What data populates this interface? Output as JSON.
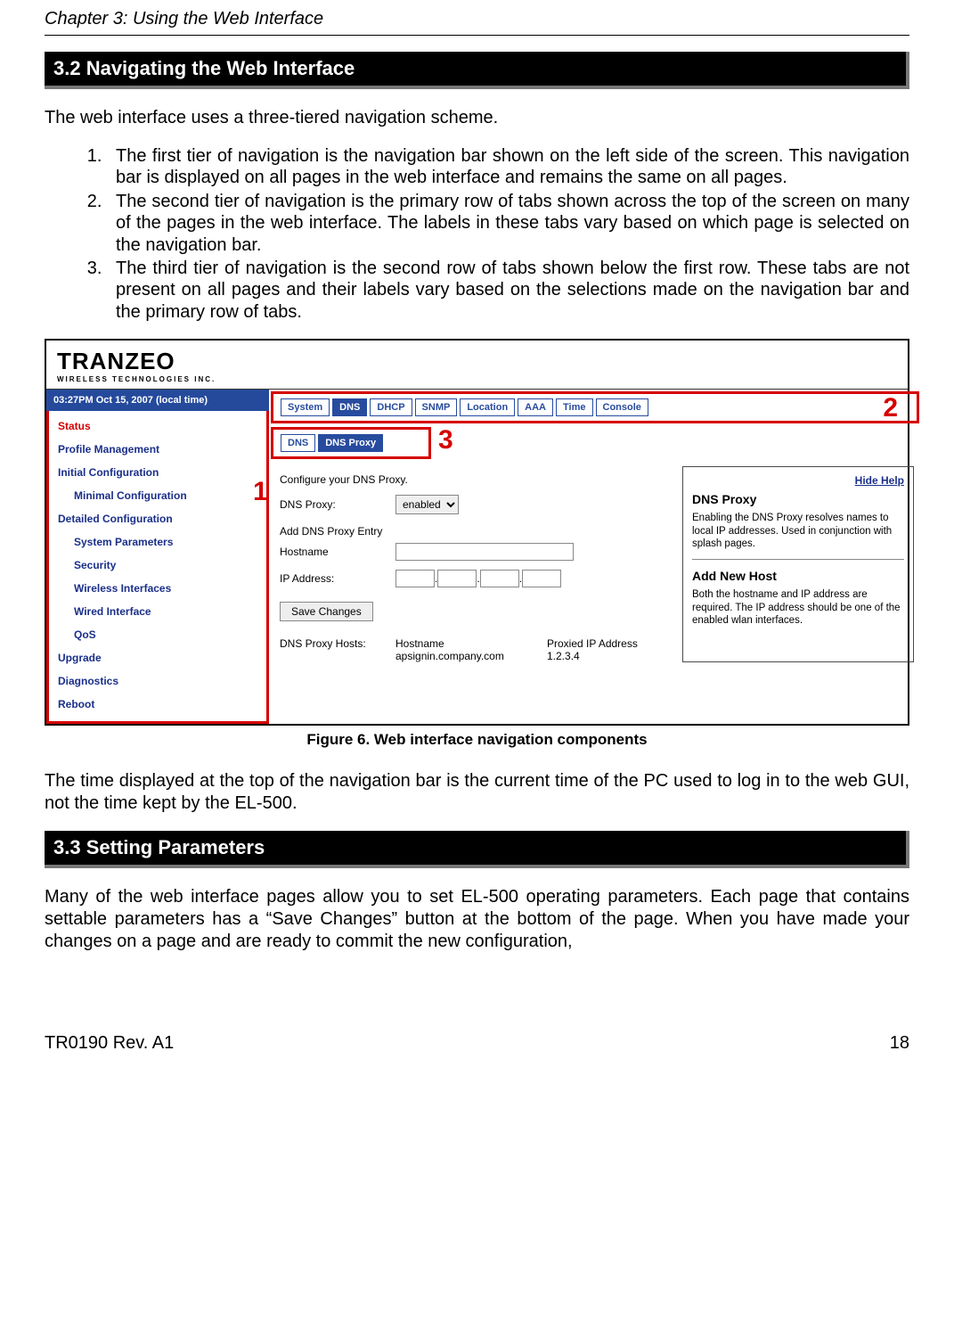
{
  "chapter_title": "Chapter 3: Using the Web Interface",
  "section_3_2": {
    "heading": "3.2     Navigating the Web Interface",
    "intro": "The web interface uses a three-tiered navigation scheme.",
    "items": [
      "The first tier of navigation is the navigation bar shown on the left side of the screen. This navigation bar is displayed on all pages in the web interface and remains the same on all pages.",
      "The second tier of navigation is the primary row of tabs shown across the top of the screen on many of the pages in the web interface. The labels in these tabs vary based on which page is selected on the navigation bar.",
      "The third tier of navigation is the second row of tabs shown below the first row. These tabs are not present on all pages and their labels vary based on the selections made on the navigation bar and the primary row of tabs."
    ]
  },
  "screenshot": {
    "logo": {
      "line1": "TRANZEO",
      "line2": "WIRELESS TECHNOLOGIES INC."
    },
    "clock": "03:27PM Oct 15, 2007 (local time)",
    "nav": [
      {
        "label": "Status",
        "cls": "status"
      },
      {
        "label": "Profile Management",
        "cls": ""
      },
      {
        "label": "Initial Configuration",
        "cls": ""
      },
      {
        "label": "Minimal Configuration",
        "cls": "child"
      },
      {
        "label": "Detailed Configuration",
        "cls": ""
      },
      {
        "label": "System Parameters",
        "cls": "child"
      },
      {
        "label": "Security",
        "cls": "child"
      },
      {
        "label": "Wireless Interfaces",
        "cls": "child"
      },
      {
        "label": "Wired Interface",
        "cls": "child"
      },
      {
        "label": "QoS",
        "cls": "child"
      },
      {
        "label": "Upgrade",
        "cls": ""
      },
      {
        "label": "Diagnostics",
        "cls": ""
      },
      {
        "label": "Reboot",
        "cls": ""
      }
    ],
    "tabs_primary": [
      "System",
      "DNS",
      "DHCP",
      "SNMP",
      "Location",
      "AAA",
      "Time",
      "Console"
    ],
    "tabs_primary_active": "DNS",
    "tabs_secondary": [
      "DNS",
      "DNS Proxy"
    ],
    "tabs_secondary_active": "DNS Proxy",
    "desc": "Configure your DNS Proxy.",
    "dns_proxy_label": "DNS Proxy:",
    "dns_proxy_value": "enabled",
    "add_entry_heading": "Add DNS Proxy Entry",
    "hostname_label": "Hostname",
    "ip_label": "IP Address:",
    "save_btn": "Save Changes",
    "hosts_heading": "DNS Proxy Hosts:",
    "hosts_table": {
      "col1": "Hostname",
      "col2": "Proxied IP Address",
      "row_host": "apsignin.company.com",
      "row_ip": "1.2.3.4"
    },
    "help": {
      "hide": "Hide Help",
      "h1_title": "DNS Proxy",
      "h1_body": "Enabling the DNS Proxy resolves names to local IP addresses. Used in conjunction with splash pages.",
      "h2_title": "Add New Host",
      "h2_body": "Both the hostname and IP address are required. The IP address should be one of the enabled wlan interfaces."
    },
    "annotations": {
      "a1": "1",
      "a2": "2",
      "a3": "3"
    }
  },
  "figure_caption": "Figure 6. Web interface navigation components",
  "after_figure": "The time displayed at the top of the navigation bar is the current time of the PC used to log in to the web GUI, not the time kept by the EL-500.",
  "section_3_3": {
    "heading": "3.3     Setting Parameters",
    "body": "Many of the web interface pages allow you to set EL-500 operating parameters. Each page that contains settable parameters has a “Save Changes” button at the bottom of the page. When you have made your changes on a page and are ready to commit the new configuration,"
  },
  "footer": {
    "left": "TR0190 Rev. A1",
    "right": "18"
  }
}
